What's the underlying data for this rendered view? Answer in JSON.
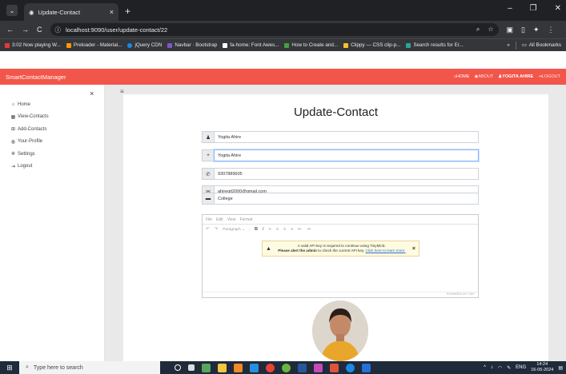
{
  "browser": {
    "tab_title": "Update-Contact",
    "url": "localhost:9090/user/update-contact/22",
    "bookmarks": [
      {
        "label": "3:02 Now playing W...",
        "color": "#e53935"
      },
      {
        "label": "Preloader - Material...",
        "color": "#ff9800"
      },
      {
        "label": "jQuery CDN",
        "color": "#1e88e5"
      },
      {
        "label": "Navbar · Bootstrap",
        "color": "#7e57c2"
      },
      {
        "label": "fa-home: Font Awes...",
        "color": "#ffffff"
      },
      {
        "label": "How to Create and...",
        "color": "#43a047"
      },
      {
        "label": "Clippy — CSS clip-p...",
        "color": "#fbc02d"
      },
      {
        "label": "Search results for Er...",
        "color": "#26a69a"
      }
    ],
    "all_bookmarks": "All Bookmarks"
  },
  "navbar": {
    "brand": "SmartContactManager",
    "home": "HOME",
    "about": "ABOUT",
    "user": "YOGITA AHIRE",
    "logout": "LOGOUT"
  },
  "sidebar": {
    "items": [
      {
        "label": "Home",
        "icon": "home-icon"
      },
      {
        "label": "View-Contacts",
        "icon": "contacts-icon"
      },
      {
        "label": "Add-Contacts",
        "icon": "add-icon"
      },
      {
        "label": "Your-Profile",
        "icon": "user-icon"
      },
      {
        "label": "Settings",
        "icon": "gear-icon"
      },
      {
        "label": "Logout",
        "icon": "logout-icon"
      }
    ]
  },
  "form": {
    "title": "Update-Contact",
    "name": "Yogita Ahire",
    "nickname": "Yogita Ahire",
    "phone": "9307889605",
    "email": "ahiregit2000@gmail.com",
    "work": "College"
  },
  "editor": {
    "menu": [
      "File",
      "Edit",
      "View",
      "Format"
    ],
    "paragraph": "Paragraph",
    "warning_line1": "A valid API key is required to continue using TinyMCE.",
    "warning_line2a": "Please alert the admin",
    "warning_line2b": " to check the current API key. ",
    "warning_link": "Click here to learn more.",
    "powered": "POWERED BY TINY"
  },
  "taskbar": {
    "search_placeholder": "Type here to search",
    "lang": "ENG",
    "time": "14:24",
    "date": "16-05-2024"
  }
}
